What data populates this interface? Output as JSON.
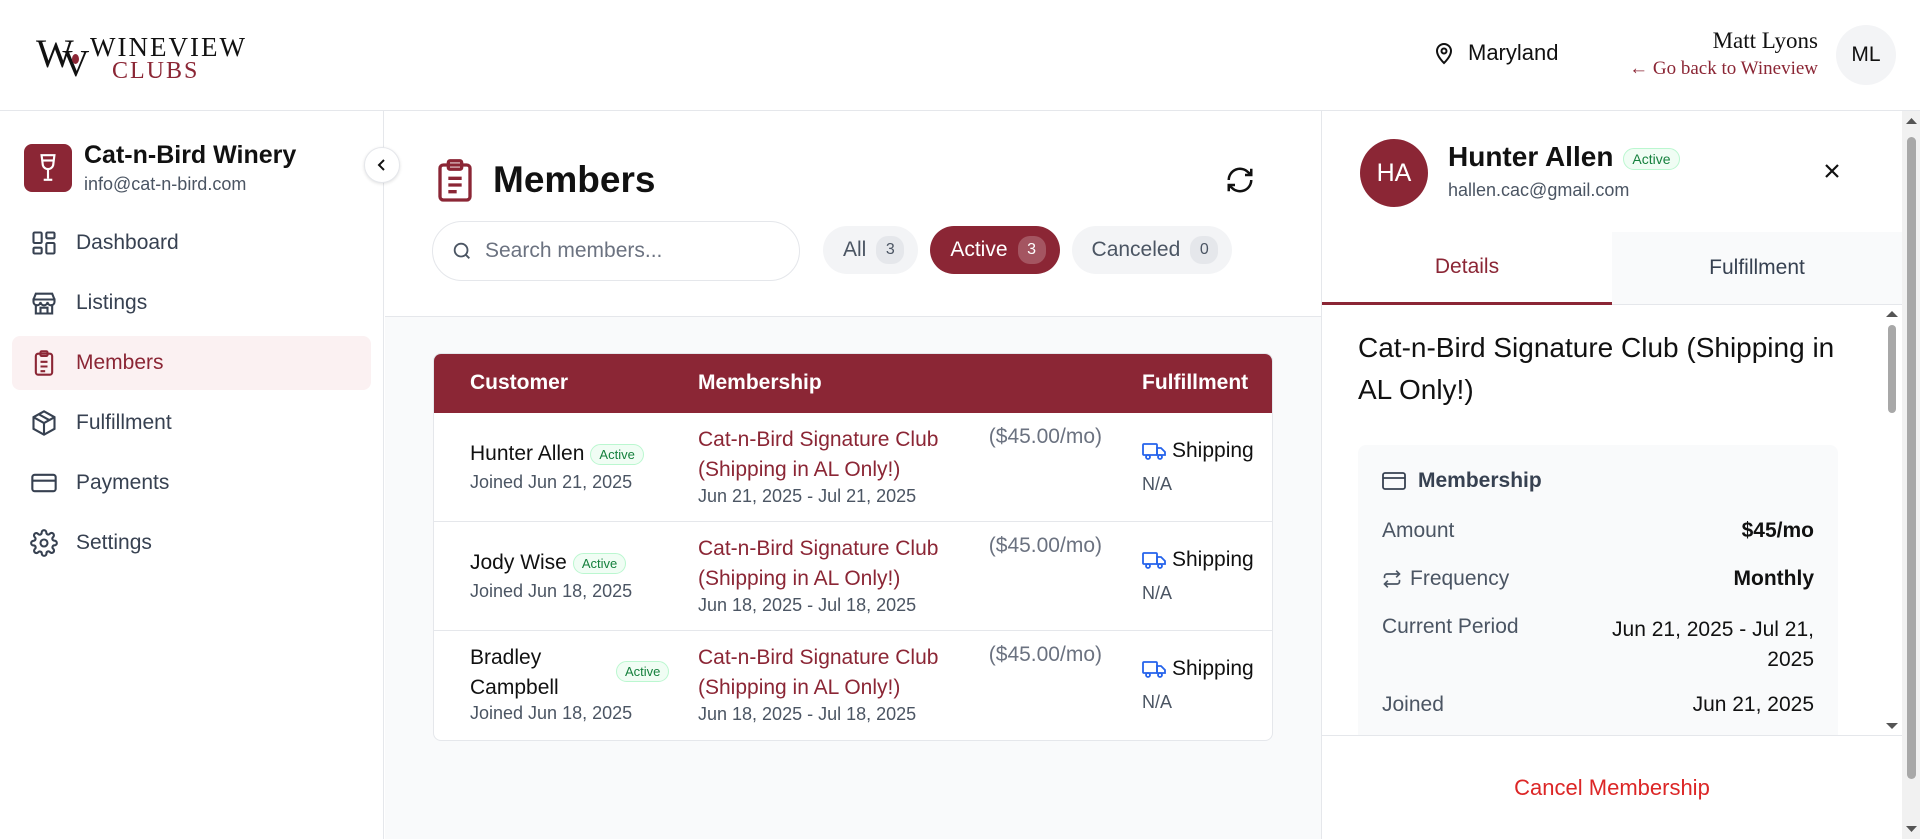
{
  "brand": {
    "line1": "WINEVIEW",
    "line2": "CLUBS",
    "accent": "#8b2635"
  },
  "header": {
    "location": "Maryland",
    "user_name": "Matt Lyons",
    "back_link": "← Go back to Wineview",
    "avatar_initials": "ML"
  },
  "sidebar": {
    "org_name": "Cat-n-Bird Winery",
    "org_email": "info@cat-n-bird.com",
    "items": [
      {
        "label": "Dashboard",
        "icon": "dashboard-icon"
      },
      {
        "label": "Listings",
        "icon": "store-icon"
      },
      {
        "label": "Members",
        "icon": "clipboard-icon",
        "active": true
      },
      {
        "label": "Fulfillment",
        "icon": "package-icon"
      },
      {
        "label": "Payments",
        "icon": "credit-card-icon"
      },
      {
        "label": "Settings",
        "icon": "gear-icon"
      }
    ]
  },
  "main": {
    "title": "Members",
    "search_placeholder": "Search members...",
    "filters": [
      {
        "label": "All",
        "count": "3"
      },
      {
        "label": "Active",
        "count": "3",
        "active": true
      },
      {
        "label": "Canceled",
        "count": "0"
      }
    ],
    "columns": [
      "Customer",
      "Membership",
      "Fulfillment"
    ],
    "rows": [
      {
        "name": "Hunter Allen",
        "status": "Active",
        "joined": "Joined Jun 21, 2025",
        "membership": "Cat-n-Bird Signature Club (Shipping in AL Only!)",
        "price": "($45.00/mo)",
        "period": "Jun 21, 2025 - Jul 21, 2025",
        "fulfillment": "Shipping",
        "fulfillment_detail": "N/A"
      },
      {
        "name": "Jody Wise",
        "status": "Active",
        "joined": "Joined Jun 18, 2025",
        "membership": "Cat-n-Bird Signature Club (Shipping in AL Only!)",
        "price": "($45.00/mo)",
        "period": "Jun 18, 2025 - Jul 18, 2025",
        "fulfillment": "Shipping",
        "fulfillment_detail": "N/A"
      },
      {
        "name": "Bradley Campbell",
        "status": "Active",
        "joined": "Joined Jun 18, 2025",
        "membership": "Cat-n-Bird Signature Club (Shipping in AL Only!)",
        "price": "($45.00/mo)",
        "period": "Jun 18, 2025 - Jul 18, 2025",
        "fulfillment": "Shipping",
        "fulfillment_detail": "N/A"
      }
    ]
  },
  "panel": {
    "initials": "HA",
    "name": "Hunter Allen",
    "status": "Active",
    "email": "hallen.cac@gmail.com",
    "tabs": [
      "Details",
      "Fulfillment"
    ],
    "club_name": "Cat-n-Bird Signature Club (Shipping in AL Only!)",
    "card_title": "Membership",
    "amount_label": "Amount",
    "amount_value": "$45/mo",
    "frequency_label": "Frequency",
    "frequency_value": "Monthly",
    "period_label": "Current Period",
    "period_value": "Jun 21, 2025 - Jul 21, 2025",
    "joined_label": "Joined",
    "joined_value": "Jun 21, 2025",
    "cancel_label": "Cancel Membership"
  }
}
